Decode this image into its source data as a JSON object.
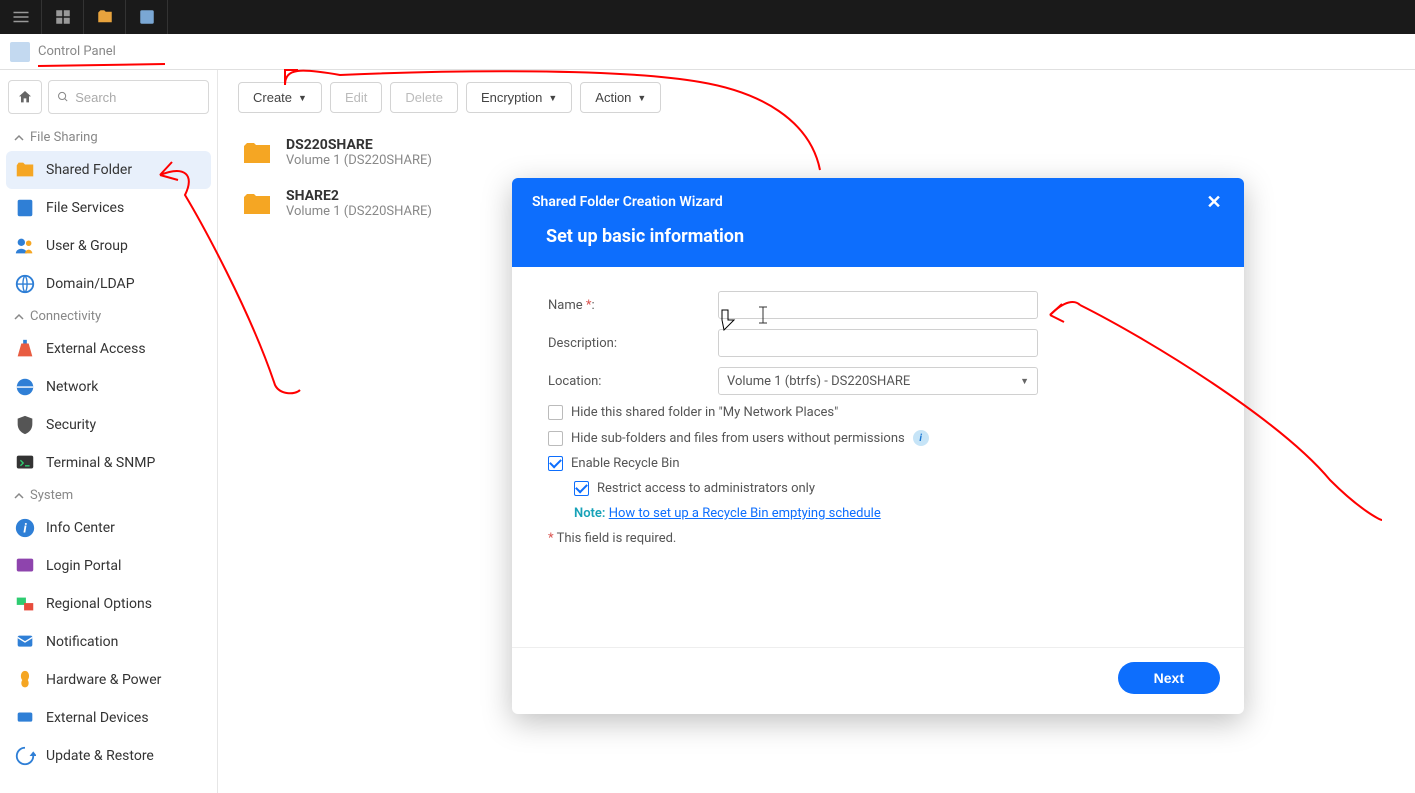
{
  "app_title": "Control Panel",
  "search_placeholder": "Search",
  "sidebar": {
    "sections": [
      {
        "label": "File Sharing",
        "items": [
          {
            "label": "Shared Folder",
            "active": true
          },
          {
            "label": "File Services"
          },
          {
            "label": "User & Group"
          },
          {
            "label": "Domain/LDAP"
          }
        ]
      },
      {
        "label": "Connectivity",
        "items": [
          {
            "label": "External Access"
          },
          {
            "label": "Network"
          },
          {
            "label": "Security"
          },
          {
            "label": "Terminal & SNMP"
          }
        ]
      },
      {
        "label": "System",
        "items": [
          {
            "label": "Info Center"
          },
          {
            "label": "Login Portal"
          },
          {
            "label": "Regional Options"
          },
          {
            "label": "Notification"
          },
          {
            "label": "Hardware & Power"
          },
          {
            "label": "External Devices"
          },
          {
            "label": "Update & Restore"
          }
        ]
      }
    ]
  },
  "toolbar": {
    "create": "Create",
    "edit": "Edit",
    "delete": "Delete",
    "encryption": "Encryption",
    "action": "Action"
  },
  "folders": [
    {
      "name": "DS220SHARE",
      "sub": "Volume 1 (DS220SHARE)"
    },
    {
      "name": "SHARE2",
      "sub": "Volume 1 (DS220SHARE)"
    }
  ],
  "modal": {
    "title": "Shared Folder Creation Wizard",
    "subtitle": "Set up basic information",
    "labels": {
      "name": "Name",
      "description": "Description:",
      "location": "Location:"
    },
    "location_value": "Volume 1 (btrfs) - DS220SHARE",
    "checkboxes": {
      "hide_network": "Hide this shared folder in \"My Network Places\"",
      "hide_subfolders": "Hide sub-folders and files from users without permissions",
      "recycle_bin": "Enable Recycle Bin",
      "restrict_admin": "Restrict access to administrators only"
    },
    "note_label": "Note:",
    "note_link": "How to set up a Recycle Bin emptying schedule",
    "required_note": "This field is required.",
    "next": "Next"
  }
}
